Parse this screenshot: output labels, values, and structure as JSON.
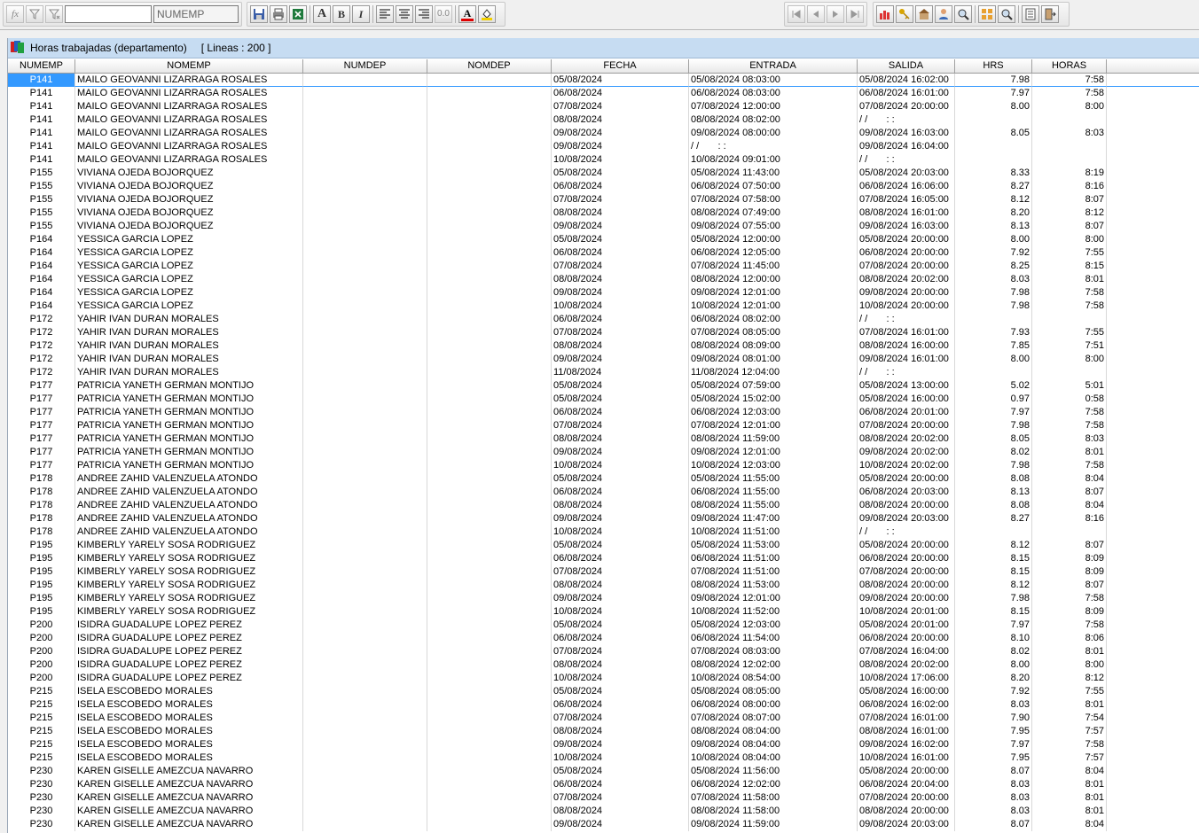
{
  "toolbar": {
    "fx_label": "fx",
    "search_value": "",
    "field_value": "NUMEMP",
    "bold_label": "B",
    "italic_label": "I",
    "decimal_label": "0.0",
    "font_label": "A",
    "color_label": "A"
  },
  "window": {
    "title": "Horas trabajadas (departamento)",
    "lines_label": "[ Lineas : 200 ]"
  },
  "columns": [
    "NUMEMP",
    "NOMEMP",
    "NUMDEP",
    "NOMDEP",
    "FECHA",
    "ENTRADA",
    "SALIDA",
    "HRS",
    "HORAS"
  ],
  "rows": [
    [
      "P141",
      "MAILO GEOVANNI LIZARRAGA ROSALES",
      "",
      "",
      "05/08/2024",
      "05/08/2024 08:03:00",
      "05/08/2024 16:02:00",
      "7.98",
      "7:58"
    ],
    [
      "P141",
      "MAILO GEOVANNI LIZARRAGA ROSALES",
      "",
      "",
      "06/08/2024",
      "06/08/2024 08:03:00",
      "06/08/2024 16:01:00",
      "7.97",
      "7:58"
    ],
    [
      "P141",
      "MAILO GEOVANNI LIZARRAGA ROSALES",
      "",
      "",
      "07/08/2024",
      "07/08/2024 12:00:00",
      "07/08/2024 20:00:00",
      "8.00",
      "8:00"
    ],
    [
      "P141",
      "MAILO GEOVANNI LIZARRAGA ROSALES",
      "",
      "",
      "08/08/2024",
      "08/08/2024 08:02:00",
      "/ /       : :",
      "",
      ""
    ],
    [
      "P141",
      "MAILO GEOVANNI LIZARRAGA ROSALES",
      "",
      "",
      "09/08/2024",
      "09/08/2024 08:00:00",
      "09/08/2024 16:03:00",
      "8.05",
      "8:03"
    ],
    [
      "P141",
      "MAILO GEOVANNI LIZARRAGA ROSALES",
      "",
      "",
      "09/08/2024",
      "/ /       : :",
      "09/08/2024 16:04:00",
      "",
      ""
    ],
    [
      "P141",
      "MAILO GEOVANNI LIZARRAGA ROSALES",
      "",
      "",
      "10/08/2024",
      "10/08/2024 09:01:00",
      "/ /       : :",
      "",
      ""
    ],
    [
      "P155",
      "VIVIANA OJEDA BOJORQUEZ",
      "",
      "",
      "05/08/2024",
      "05/08/2024 11:43:00",
      "05/08/2024 20:03:00",
      "8.33",
      "8:19"
    ],
    [
      "P155",
      "VIVIANA OJEDA BOJORQUEZ",
      "",
      "",
      "06/08/2024",
      "06/08/2024 07:50:00",
      "06/08/2024 16:06:00",
      "8.27",
      "8:16"
    ],
    [
      "P155",
      "VIVIANA OJEDA BOJORQUEZ",
      "",
      "",
      "07/08/2024",
      "07/08/2024 07:58:00",
      "07/08/2024 16:05:00",
      "8.12",
      "8:07"
    ],
    [
      "P155",
      "VIVIANA OJEDA BOJORQUEZ",
      "",
      "",
      "08/08/2024",
      "08/08/2024 07:49:00",
      "08/08/2024 16:01:00",
      "8.20",
      "8:12"
    ],
    [
      "P155",
      "VIVIANA OJEDA BOJORQUEZ",
      "",
      "",
      "09/08/2024",
      "09/08/2024 07:55:00",
      "09/08/2024 16:03:00",
      "8.13",
      "8:07"
    ],
    [
      "P164",
      "YESSICA GARCIA LOPEZ",
      "",
      "",
      "05/08/2024",
      "05/08/2024 12:00:00",
      "05/08/2024 20:00:00",
      "8.00",
      "8:00"
    ],
    [
      "P164",
      "YESSICA GARCIA LOPEZ",
      "",
      "",
      "06/08/2024",
      "06/08/2024 12:05:00",
      "06/08/2024 20:00:00",
      "7.92",
      "7:55"
    ],
    [
      "P164",
      "YESSICA GARCIA LOPEZ",
      "",
      "",
      "07/08/2024",
      "07/08/2024 11:45:00",
      "07/08/2024 20:00:00",
      "8.25",
      "8:15"
    ],
    [
      "P164",
      "YESSICA GARCIA LOPEZ",
      "",
      "",
      "08/08/2024",
      "08/08/2024 12:00:00",
      "08/08/2024 20:02:00",
      "8.03",
      "8:01"
    ],
    [
      "P164",
      "YESSICA GARCIA LOPEZ",
      "",
      "",
      "09/08/2024",
      "09/08/2024 12:01:00",
      "09/08/2024 20:00:00",
      "7.98",
      "7:58"
    ],
    [
      "P164",
      "YESSICA GARCIA LOPEZ",
      "",
      "",
      "10/08/2024",
      "10/08/2024 12:01:00",
      "10/08/2024 20:00:00",
      "7.98",
      "7:58"
    ],
    [
      "P172",
      "YAHIR IVAN DURAN MORALES",
      "",
      "",
      "06/08/2024",
      "06/08/2024 08:02:00",
      "/ /       : :",
      "",
      ""
    ],
    [
      "P172",
      "YAHIR IVAN DURAN MORALES",
      "",
      "",
      "07/08/2024",
      "07/08/2024 08:05:00",
      "07/08/2024 16:01:00",
      "7.93",
      "7:55"
    ],
    [
      "P172",
      "YAHIR IVAN DURAN MORALES",
      "",
      "",
      "08/08/2024",
      "08/08/2024 08:09:00",
      "08/08/2024 16:00:00",
      "7.85",
      "7:51"
    ],
    [
      "P172",
      "YAHIR IVAN DURAN MORALES",
      "",
      "",
      "09/08/2024",
      "09/08/2024 08:01:00",
      "09/08/2024 16:01:00",
      "8.00",
      "8:00"
    ],
    [
      "P172",
      "YAHIR IVAN DURAN MORALES",
      "",
      "",
      "11/08/2024",
      "11/08/2024 12:04:00",
      "/ /       : :",
      "",
      ""
    ],
    [
      "P177",
      "PATRICIA YANETH GERMAN MONTIJO",
      "",
      "",
      "05/08/2024",
      "05/08/2024 07:59:00",
      "05/08/2024 13:00:00",
      "5.02",
      "5:01"
    ],
    [
      "P177",
      "PATRICIA YANETH GERMAN MONTIJO",
      "",
      "",
      "05/08/2024",
      "05/08/2024 15:02:00",
      "05/08/2024 16:00:00",
      "0.97",
      "0:58"
    ],
    [
      "P177",
      "PATRICIA YANETH GERMAN MONTIJO",
      "",
      "",
      "06/08/2024",
      "06/08/2024 12:03:00",
      "06/08/2024 20:01:00",
      "7.97",
      "7:58"
    ],
    [
      "P177",
      "PATRICIA YANETH GERMAN MONTIJO",
      "",
      "",
      "07/08/2024",
      "07/08/2024 12:01:00",
      "07/08/2024 20:00:00",
      "7.98",
      "7:58"
    ],
    [
      "P177",
      "PATRICIA YANETH GERMAN MONTIJO",
      "",
      "",
      "08/08/2024",
      "08/08/2024 11:59:00",
      "08/08/2024 20:02:00",
      "8.05",
      "8:03"
    ],
    [
      "P177",
      "PATRICIA YANETH GERMAN MONTIJO",
      "",
      "",
      "09/08/2024",
      "09/08/2024 12:01:00",
      "09/08/2024 20:02:00",
      "8.02",
      "8:01"
    ],
    [
      "P177",
      "PATRICIA YANETH GERMAN MONTIJO",
      "",
      "",
      "10/08/2024",
      "10/08/2024 12:03:00",
      "10/08/2024 20:02:00",
      "7.98",
      "7:58"
    ],
    [
      "P178",
      "ANDREE ZAHID VALENZUELA ATONDO",
      "",
      "",
      "05/08/2024",
      "05/08/2024 11:55:00",
      "05/08/2024 20:00:00",
      "8.08",
      "8:04"
    ],
    [
      "P178",
      "ANDREE ZAHID VALENZUELA ATONDO",
      "",
      "",
      "06/08/2024",
      "06/08/2024 11:55:00",
      "06/08/2024 20:03:00",
      "8.13",
      "8:07"
    ],
    [
      "P178",
      "ANDREE ZAHID VALENZUELA ATONDO",
      "",
      "",
      "08/08/2024",
      "08/08/2024 11:55:00",
      "08/08/2024 20:00:00",
      "8.08",
      "8:04"
    ],
    [
      "P178",
      "ANDREE ZAHID VALENZUELA ATONDO",
      "",
      "",
      "09/08/2024",
      "09/08/2024 11:47:00",
      "09/08/2024 20:03:00",
      "8.27",
      "8:16"
    ],
    [
      "P178",
      "ANDREE ZAHID VALENZUELA ATONDO",
      "",
      "",
      "10/08/2024",
      "10/08/2024 11:51:00",
      "/ /       : :",
      "",
      ""
    ],
    [
      "P195",
      "KIMBERLY YARELY SOSA RODRIGUEZ",
      "",
      "",
      "05/08/2024",
      "05/08/2024 11:53:00",
      "05/08/2024 20:00:00",
      "8.12",
      "8:07"
    ],
    [
      "P195",
      "KIMBERLY YARELY SOSA RODRIGUEZ",
      "",
      "",
      "06/08/2024",
      "06/08/2024 11:51:00",
      "06/08/2024 20:00:00",
      "8.15",
      "8:09"
    ],
    [
      "P195",
      "KIMBERLY YARELY SOSA RODRIGUEZ",
      "",
      "",
      "07/08/2024",
      "07/08/2024 11:51:00",
      "07/08/2024 20:00:00",
      "8.15",
      "8:09"
    ],
    [
      "P195",
      "KIMBERLY YARELY SOSA RODRIGUEZ",
      "",
      "",
      "08/08/2024",
      "08/08/2024 11:53:00",
      "08/08/2024 20:00:00",
      "8.12",
      "8:07"
    ],
    [
      "P195",
      "KIMBERLY YARELY SOSA RODRIGUEZ",
      "",
      "",
      "09/08/2024",
      "09/08/2024 12:01:00",
      "09/08/2024 20:00:00",
      "7.98",
      "7:58"
    ],
    [
      "P195",
      "KIMBERLY YARELY SOSA RODRIGUEZ",
      "",
      "",
      "10/08/2024",
      "10/08/2024 11:52:00",
      "10/08/2024 20:01:00",
      "8.15",
      "8:09"
    ],
    [
      "P200",
      "ISIDRA GUADALUPE LOPEZ PEREZ",
      "",
      "",
      "05/08/2024",
      "05/08/2024 12:03:00",
      "05/08/2024 20:01:00",
      "7.97",
      "7:58"
    ],
    [
      "P200",
      "ISIDRA GUADALUPE LOPEZ PEREZ",
      "",
      "",
      "06/08/2024",
      "06/08/2024 11:54:00",
      "06/08/2024 20:00:00",
      "8.10",
      "8:06"
    ],
    [
      "P200",
      "ISIDRA GUADALUPE LOPEZ PEREZ",
      "",
      "",
      "07/08/2024",
      "07/08/2024 08:03:00",
      "07/08/2024 16:04:00",
      "8.02",
      "8:01"
    ],
    [
      "P200",
      "ISIDRA GUADALUPE LOPEZ PEREZ",
      "",
      "",
      "08/08/2024",
      "08/08/2024 12:02:00",
      "08/08/2024 20:02:00",
      "8.00",
      "8:00"
    ],
    [
      "P200",
      "ISIDRA GUADALUPE LOPEZ PEREZ",
      "",
      "",
      "10/08/2024",
      "10/08/2024 08:54:00",
      "10/08/2024 17:06:00",
      "8.20",
      "8:12"
    ],
    [
      "P215",
      "ISELA ESCOBEDO MORALES",
      "",
      "",
      "05/08/2024",
      "05/08/2024 08:05:00",
      "05/08/2024 16:00:00",
      "7.92",
      "7:55"
    ],
    [
      "P215",
      "ISELA ESCOBEDO MORALES",
      "",
      "",
      "06/08/2024",
      "06/08/2024 08:00:00",
      "06/08/2024 16:02:00",
      "8.03",
      "8:01"
    ],
    [
      "P215",
      "ISELA ESCOBEDO MORALES",
      "",
      "",
      "07/08/2024",
      "07/08/2024 08:07:00",
      "07/08/2024 16:01:00",
      "7.90",
      "7:54"
    ],
    [
      "P215",
      "ISELA ESCOBEDO MORALES",
      "",
      "",
      "08/08/2024",
      "08/08/2024 08:04:00",
      "08/08/2024 16:01:00",
      "7.95",
      "7:57"
    ],
    [
      "P215",
      "ISELA ESCOBEDO MORALES",
      "",
      "",
      "09/08/2024",
      "09/08/2024 08:04:00",
      "09/08/2024 16:02:00",
      "7.97",
      "7:58"
    ],
    [
      "P215",
      "ISELA ESCOBEDO MORALES",
      "",
      "",
      "10/08/2024",
      "10/08/2024 08:04:00",
      "10/08/2024 16:01:00",
      "7.95",
      "7:57"
    ],
    [
      "P230",
      "KAREN GISELLE AMEZCUA NAVARRO",
      "",
      "",
      "05/08/2024",
      "05/08/2024 11:56:00",
      "05/08/2024 20:00:00",
      "8.07",
      "8:04"
    ],
    [
      "P230",
      "KAREN GISELLE AMEZCUA NAVARRO",
      "",
      "",
      "06/08/2024",
      "06/08/2024 12:02:00",
      "06/08/2024 20:04:00",
      "8.03",
      "8:01"
    ],
    [
      "P230",
      "KAREN GISELLE AMEZCUA NAVARRO",
      "",
      "",
      "07/08/2024",
      "07/08/2024 11:58:00",
      "07/08/2024 20:00:00",
      "8.03",
      "8:01"
    ],
    [
      "P230",
      "KAREN GISELLE AMEZCUA NAVARRO",
      "",
      "",
      "08/08/2024",
      "08/08/2024 11:58:00",
      "08/08/2024 20:00:00",
      "8.03",
      "8:01"
    ],
    [
      "P230",
      "KAREN GISELLE AMEZCUA NAVARRO",
      "",
      "",
      "09/08/2024",
      "09/08/2024 11:59:00",
      "09/08/2024 20:03:00",
      "8.07",
      "8:04"
    ]
  ],
  "icons": {
    "fx": "function-icon",
    "filter": "filter-icon",
    "filter2": "filter-clear-icon",
    "save": "save-icon",
    "print": "print-icon",
    "excel": "excel-icon",
    "font": "font-icon",
    "align_left": "align-left-icon",
    "align_center": "align-center-icon",
    "align_right": "align-right-icon",
    "font_color": "font-color-icon",
    "fill_color": "fill-color-icon",
    "first": "first-record-icon",
    "prev": "previous-record-icon",
    "next": "next-record-icon",
    "last": "last-record-icon",
    "chart": "chart-icon",
    "key": "key-icon",
    "building": "building-icon",
    "user": "user-icon",
    "search": "search-icon",
    "grid": "grid-icon",
    "zoom": "zoom-icon",
    "columns": "columns-icon",
    "exit": "exit-icon",
    "app": "app-icon"
  },
  "colors": {
    "selection": "#3399ff",
    "titlebar": "#c6dcf2"
  }
}
